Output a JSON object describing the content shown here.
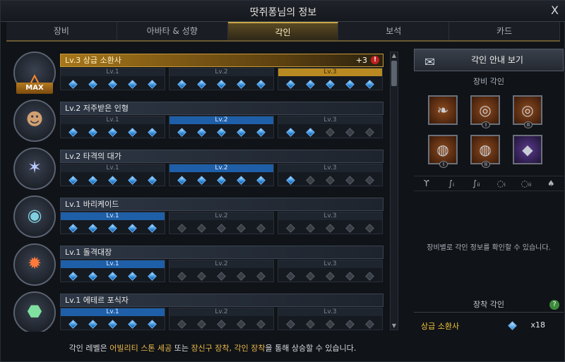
{
  "window": {
    "title": "땃쥐퐁님의 정보",
    "close": "X"
  },
  "tabs": [
    "장비",
    "아바타 & 성향",
    "각인",
    "보석",
    "카드"
  ],
  "engravings": [
    {
      "header": "Lv.3 상급 소환사",
      "badge": "MAX",
      "bonus": "+3",
      "alert": "!",
      "levels": [
        "Lv.1",
        "Lv.2",
        "Lv.3"
      ],
      "filled": 15,
      "icon": "fire-icon"
    },
    {
      "header": "Lv.2 저주받은 인형",
      "levels": [
        "Lv.1",
        "Lv.2",
        "Lv.3"
      ],
      "filled": 12,
      "icon": "doll-icon"
    },
    {
      "header": "Lv.2 타격의 대가",
      "levels": [
        "Lv.1",
        "Lv.2",
        "Lv.3"
      ],
      "filled": 11,
      "icon": "lightning-icon"
    },
    {
      "header": "Lv.1 바리케이드",
      "levels": [
        "Lv.1",
        "Lv.2",
        "Lv.3"
      ],
      "filled": 5,
      "icon": "shield-icon"
    },
    {
      "header": "Lv.1 돌격대장",
      "levels": [
        "Lv.1",
        "Lv.2",
        "Lv.3"
      ],
      "filled": 5,
      "icon": "charge-icon"
    },
    {
      "header": "Lv.1 에테르 포식자",
      "levels": [
        "Lv.1",
        "Lv.2",
        "Lv.3"
      ],
      "filled": 5,
      "icon": "ether-icon"
    }
  ],
  "footer": {
    "pre": "각인 레벨은 ",
    "hl1": "어빌리티 스톤 세공",
    "mid": " 또는 ",
    "hl2": "장신구 장착, 각인 장착",
    "post": "을 통해 상승할 수 있습니다."
  },
  "right": {
    "guide_label": "각인 안내 보기",
    "equip_section": "장비 각인",
    "info": "장비별로 각인 정보를 확인할 수 있습니다.",
    "equipped_section": "장착 각인",
    "equipped_name": "상급 소환사",
    "equipped_count": "x18",
    "help": "?"
  }
}
